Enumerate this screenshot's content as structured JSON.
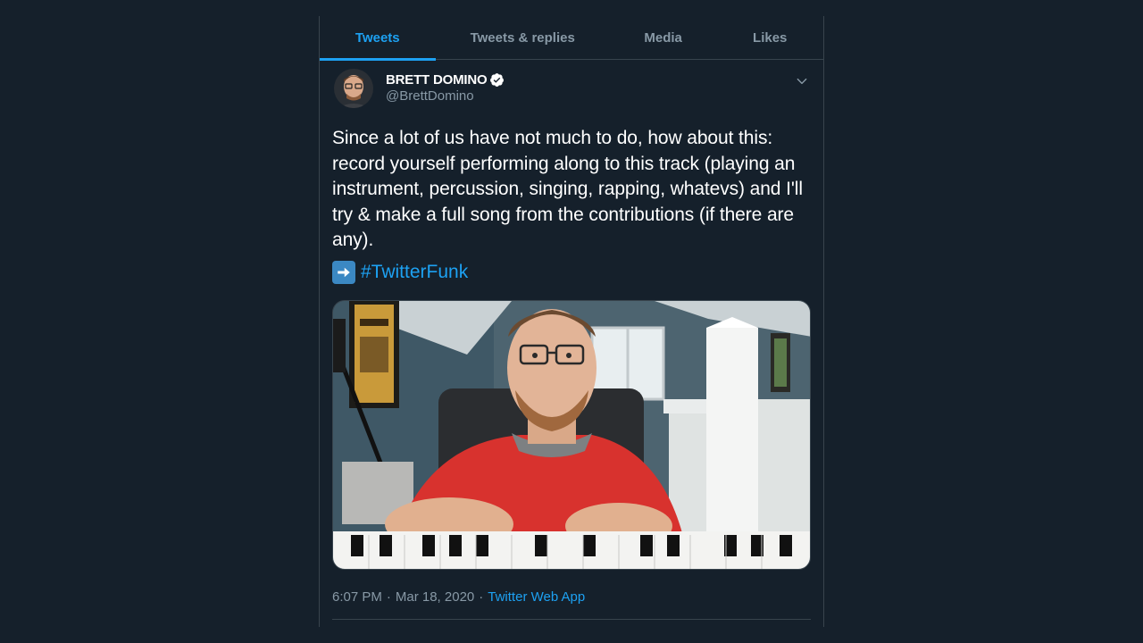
{
  "tabs": [
    {
      "label": "Tweets",
      "active": true
    },
    {
      "label": "Tweets & replies",
      "active": false
    },
    {
      "label": "Media",
      "active": false
    },
    {
      "label": "Likes",
      "active": false
    }
  ],
  "tweet": {
    "display_name": "BRETT DOMINO",
    "verified": true,
    "handle": "@BrettDomino",
    "text": "Since a lot of us have not much to do, how about this: record yourself performing along to this track (playing an instrument, percussion, singing, rapping, whatevs) and I'll try & make a full song from the contributions (if there are any).",
    "emoji": "right-arrow-emoji",
    "hashtag": "#TwitterFunk",
    "time": "6:07 PM",
    "date": "Mar 18, 2020",
    "source": "Twitter Web App",
    "separator": "·"
  },
  "colors": {
    "background": "#15202b",
    "border": "#38444d",
    "accent": "#1da1f2",
    "secondary_text": "#8899a6",
    "primary_text": "#ffffff"
  },
  "icons": {
    "verified": "verified-badge-icon",
    "caret": "chevron-down-icon"
  }
}
